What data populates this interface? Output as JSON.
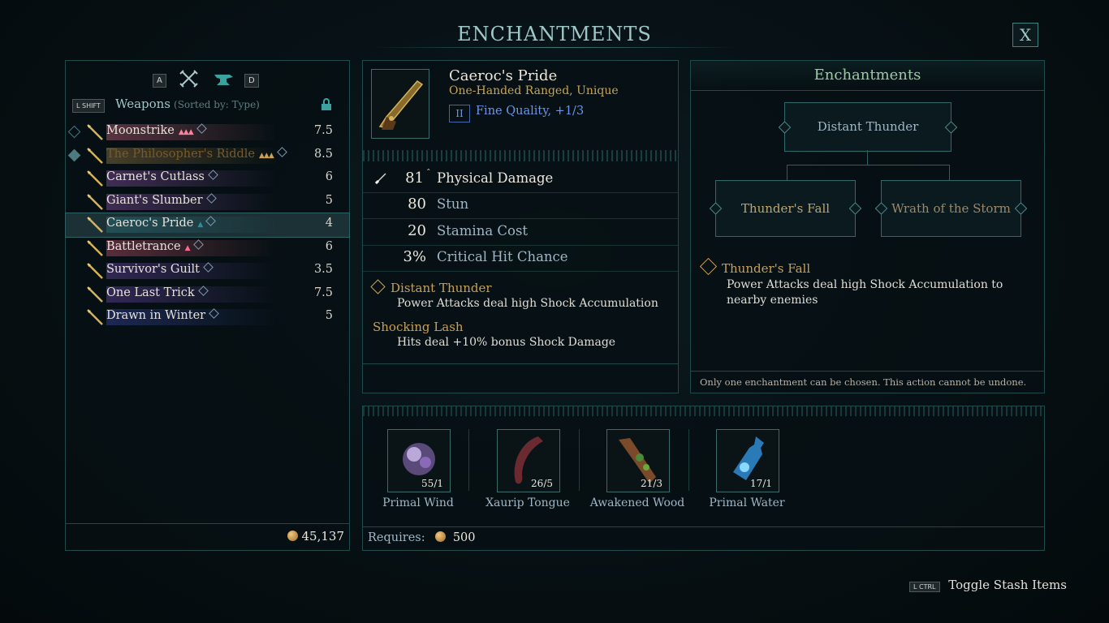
{
  "header": {
    "title": "ENCHANTMENTS",
    "close_label": "X"
  },
  "left_panel": {
    "key_prev": "A",
    "key_next": "D",
    "key_shift": "L SHIFT",
    "category_title": "Weapons",
    "sorted_label": "(Sorted by: Type)",
    "weapons": [
      {
        "name": "Moonstrike",
        "value": "7.5",
        "marks": "▲▲▲",
        "color": "#ff7f9c"
      },
      {
        "name": "The Philosopher's Riddle",
        "value": "8.5",
        "marks": "▲▲▲",
        "color": "#c9a054"
      },
      {
        "name": "Carnet's Cutlass",
        "value": "6",
        "marks": "",
        "color": "#b46ad6"
      },
      {
        "name": "Giant's Slumber",
        "value": "5",
        "marks": "",
        "color": "#b46ad6"
      },
      {
        "name": "Caeroc's Pride",
        "value": "4",
        "marks": "▲",
        "color": "#2f8a9a"
      },
      {
        "name": "Battletrance",
        "value": "6",
        "marks": "▲",
        "color": "#ff6a8a"
      },
      {
        "name": "Survivor's Guilt",
        "value": "3.5",
        "marks": "",
        "color": "#8a5ad6"
      },
      {
        "name": "One Last Trick",
        "value": "7.5",
        "marks": "",
        "color": "#8a5ad6"
      },
      {
        "name": "Drawn in Winter",
        "value": "5",
        "marks": "",
        "color": "#4a5ad6"
      }
    ],
    "currency": "45,137"
  },
  "item": {
    "name": "Caeroc's Pride",
    "type": "One-Handed Ranged, Unique",
    "quality_badge": "II",
    "quality": "Fine Quality, +1/3",
    "stats": [
      {
        "value": "81",
        "label": "Physical Damage"
      },
      {
        "value": "80",
        "label": "Stun"
      },
      {
        "value": "20",
        "label": "Stamina Cost"
      },
      {
        "value": "3%",
        "label": "Critical Hit Chance"
      }
    ],
    "enchant_1_title": "Distant Thunder",
    "enchant_1_desc": "Power Attacks deal high Shock Accumulation",
    "enchant_2_title": "Shocking Lash",
    "enchant_2_desc": "Hits deal +10% bonus Shock Damage"
  },
  "enchant_panel": {
    "title": "Enchantments",
    "root": "Distant Thunder",
    "option_a": "Thunder's Fall",
    "option_b": "Wrath of the Storm",
    "selected_title": "Thunder's Fall",
    "selected_desc": "Power Attacks deal high Shock Accumulation to nearby enemies",
    "footer": "Only one enchantment can be chosen. This action cannot be undone."
  },
  "materials": [
    {
      "name": "Primal Wind",
      "count": "55/1",
      "icon": "primal-wind-icon"
    },
    {
      "name": "Xaurip Tongue",
      "count": "26/5",
      "icon": "xaurip-tongue-icon"
    },
    {
      "name": "Awakened Wood",
      "count": "21/3",
      "icon": "awakened-wood-icon"
    },
    {
      "name": "Primal Water",
      "count": "17/1",
      "icon": "primal-water-icon"
    }
  ],
  "requires": {
    "label": "Requires:",
    "amount": "500"
  },
  "footer": {
    "key": "L CTRL",
    "label": "Toggle Stash Items"
  }
}
